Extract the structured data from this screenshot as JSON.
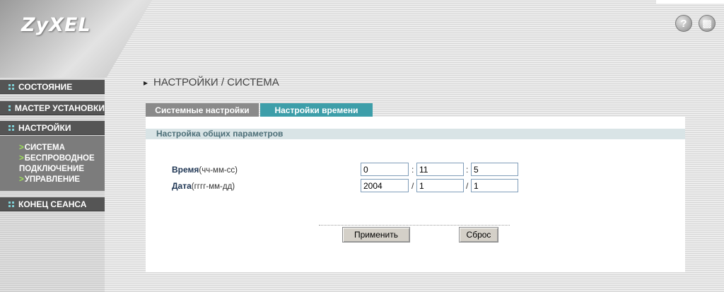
{
  "brand": {
    "logo_text": "ZyXEL"
  },
  "header": {
    "help_icon": "help-icon",
    "doc_icon": "document-icon"
  },
  "sidebar": {
    "items": [
      {
        "label": "СОСТОЯНИЕ"
      },
      {
        "label": "МАСТЕР УСТАНОВКИ"
      },
      {
        "label": "НАСТРОЙКИ"
      },
      {
        "label": "КОНЕЦ СЕАНСА"
      }
    ],
    "submenu": [
      {
        "label": "СИСТЕМА"
      },
      {
        "label_line1": "БЕСПРОВОДНОЕ",
        "label_line2": "ПОДКЛЮЧЕНИЕ"
      },
      {
        "label": "УПРАВЛЕНИЕ"
      }
    ]
  },
  "page": {
    "title": "НАСТРОЙКИ / СИСТЕМА"
  },
  "tabs": [
    {
      "label": "Системные настройки",
      "active": false
    },
    {
      "label": "Настройки времени",
      "active": true
    }
  ],
  "section": {
    "header": "Настройка общих параметров"
  },
  "form": {
    "time": {
      "label": "Время",
      "format": "(чч-мм-сс)",
      "hour": "0",
      "minute": "11",
      "second": "5",
      "separator": ":"
    },
    "date": {
      "label": "Дата",
      "format": "(гггг-мм-дд)",
      "year": "2004",
      "month": "1",
      "day": "1",
      "separator": "/"
    }
  },
  "buttons": {
    "apply": "Применить",
    "reset": "Сброс"
  },
  "colors": {
    "active_tab": "#3d9ea9",
    "inactive_tab": "#8a8a8a",
    "nav_bg": "#555555",
    "accent_arrow": "#9fe05a"
  }
}
